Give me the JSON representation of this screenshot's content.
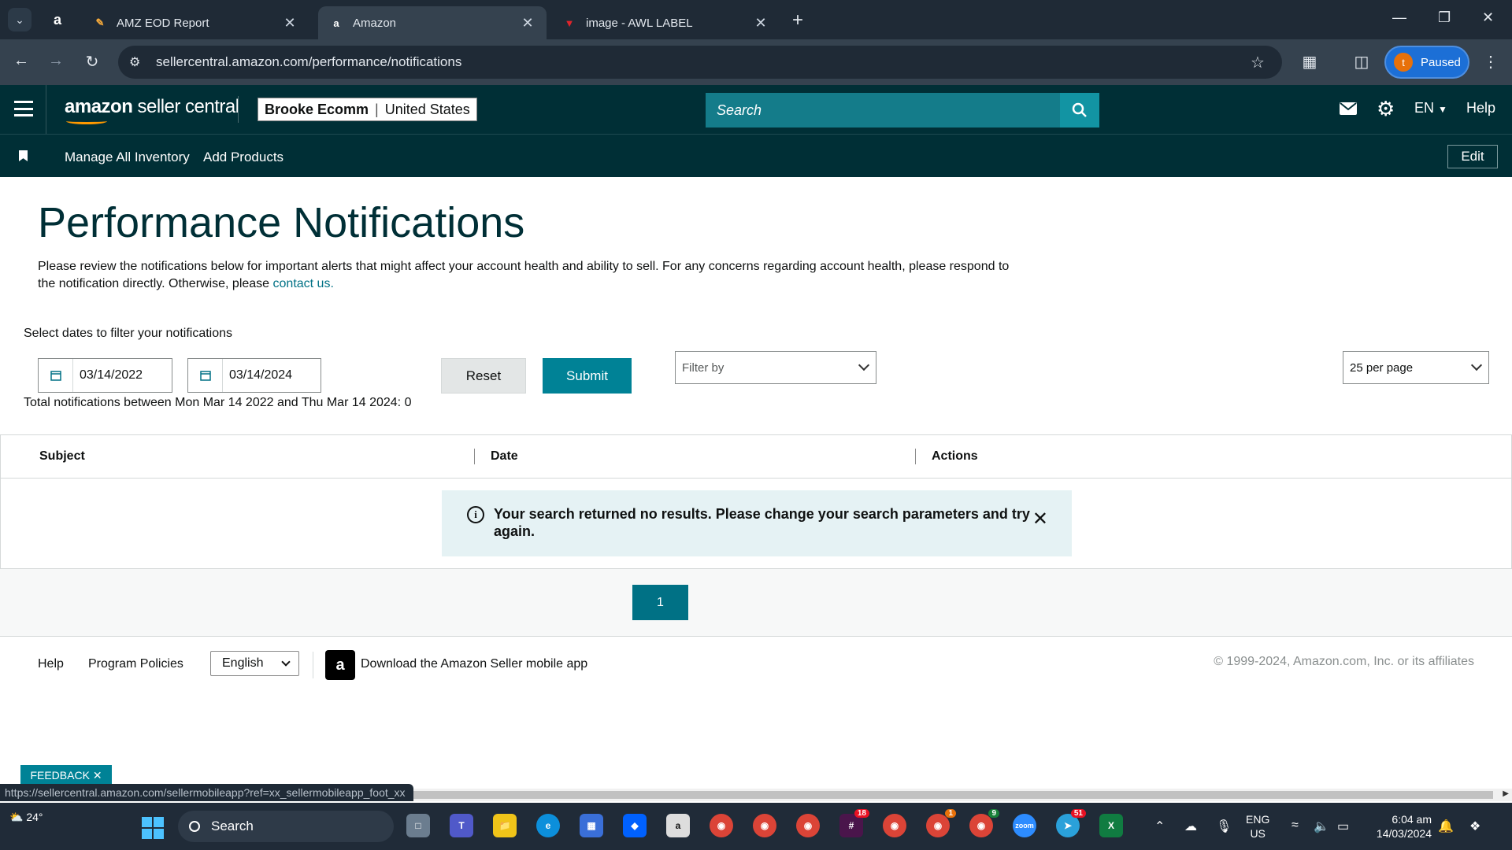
{
  "browser": {
    "tabs": [
      {
        "title": "AMZ EOD Report",
        "favicon": "craft-icon"
      },
      {
        "title": "Amazon",
        "favicon": "amazon-icon",
        "active": true
      },
      {
        "title": "image - AWL LABEL",
        "favicon": "awl-icon"
      }
    ],
    "url": "sellercentral.amazon.com/performance/notifications",
    "profile_initial": "t",
    "profile_status": "Paused"
  },
  "header": {
    "logo_bold": "amazon",
    "logo_rest": " seller central",
    "account_name": "Brooke Ecomm",
    "account_region": "United States",
    "search_placeholder": "Search",
    "language": "EN",
    "help": "Help"
  },
  "bookmarks": {
    "links": [
      "Manage All Inventory",
      "Add Products"
    ],
    "edit_label": "Edit"
  },
  "page": {
    "title": "Performance Notifications",
    "description": "Please review the notifications below for important alerts that might affect your account health and ability to sell. For any concerns regarding account health, please respond to the notification directly. Otherwise, please ",
    "contact_link": "contact us.",
    "filter_label": "Select dates to filter your notifications",
    "date_from": "03/14/2022",
    "date_to": "03/14/2024",
    "reset_label": "Reset",
    "submit_label": "Submit",
    "filter_by": "Filter by",
    "per_page": "25 per page",
    "total_line": "Total notifications between Mon Mar 14 2022 and Thu Mar 14 2024: 0"
  },
  "table": {
    "columns": [
      "Subject",
      "Date",
      "Actions"
    ],
    "empty_message": "Your search returned no results. Please change your search parameters and try again."
  },
  "pagination": {
    "current_page": "1"
  },
  "footer": {
    "help": "Help",
    "program_policies": "Program Policies",
    "language_select": "English",
    "app_text": "Download the Amazon Seller mobile app",
    "copyright": "© 1999-2024, Amazon.com, Inc. or its affiliates"
  },
  "feedback_label": "FEEDBACK",
  "status_url": "https://sellercentral.amazon.com/sellermobileapp?ref=xx_sellermobileapp_foot_xx",
  "taskbar": {
    "weather": "24°",
    "search_label": "Search",
    "lang_line1": "ENG",
    "lang_line2": "US",
    "time": "6:04 am",
    "date": "14/03/2024",
    "badges": {
      "slack": "18",
      "chrome_orange": "1",
      "chrome_green": "9",
      "telegram": "51"
    }
  },
  "colors": {
    "header_bg": "#002f36",
    "accent": "#008296",
    "search_bg": "#147c8a",
    "alert_bg": "#e5f2f4",
    "link": "#007185"
  }
}
